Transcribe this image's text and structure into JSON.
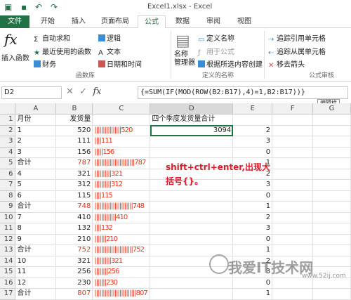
{
  "window": {
    "title": "Excel1.xlsx - Excel"
  },
  "tabs": [
    "文件",
    "开始",
    "插入",
    "页面布局",
    "公式",
    "数据",
    "审阅",
    "视图"
  ],
  "ribbon": {
    "insert_function": "插入函数",
    "autosum": "自动求和",
    "recent": "最近使用的函数",
    "financial": "财务",
    "logical": "逻辑",
    "text": "文本",
    "datetime": "日期和时间",
    "group_library": "函数库",
    "name_manager": "名称\n管理器",
    "define_name": "定义名称",
    "use_in_formula": "用于公式",
    "create_from_sel": "根据所选内容创建",
    "group_names": "定义的名称",
    "trace_prec": "追踪引用单元格",
    "trace_dep": "追踪从属单元格",
    "remove_arrows": "移去箭头",
    "group_audit": "公式审核"
  },
  "formula_bar": {
    "cell": "D2",
    "fx": "fx",
    "formula": "{=SUM(IF(MOD(ROW(B2:B17),4)=1,B2:B17))}"
  },
  "tooltip": "编辑栏",
  "columns": [
    "A",
    "B",
    "C",
    "D",
    "E",
    "F",
    "G"
  ],
  "rows": [
    {
      "n": "1",
      "a": "月份",
      "b": "发货量",
      "c": "",
      "d": "四个季度发货量合计",
      "e": "",
      "red": false
    },
    {
      "n": "2",
      "a": "1",
      "b": "520",
      "c": "||||||||||||||||520",
      "d": "3094",
      "e": "2",
      "red": false
    },
    {
      "n": "3",
      "a": "2",
      "b": "111",
      "c": "||||111",
      "d": "",
      "e": "3",
      "red": false
    },
    {
      "n": "4",
      "a": "3",
      "b": "156",
      "c": "|||||156",
      "d": "",
      "e": "0",
      "red": false
    },
    {
      "n": "5",
      "a": "合计",
      "b": "787",
      "c": "||||||||||||||||||||||||787",
      "d": "",
      "e": "1",
      "red": true
    },
    {
      "n": "6",
      "a": "4",
      "b": "321",
      "c": "||||||||||321",
      "d": "",
      "e": "2",
      "red": false
    },
    {
      "n": "7",
      "a": "5",
      "b": "312",
      "c": "||||||||||312",
      "d": "",
      "e": "3",
      "red": false
    },
    {
      "n": "8",
      "a": "6",
      "b": "115",
      "c": "||||115",
      "d": "",
      "e": "0",
      "red": false
    },
    {
      "n": "9",
      "a": "合计",
      "b": "748",
      "c": "|||||||||||||||||||||||748",
      "d": "",
      "e": "1",
      "red": true
    },
    {
      "n": "10",
      "a": "7",
      "b": "410",
      "c": "|||||||||||||410",
      "d": "",
      "e": "2",
      "red": false
    },
    {
      "n": "11",
      "a": "8",
      "b": "132",
      "c": "||||132",
      "d": "",
      "e": "3",
      "red": false
    },
    {
      "n": "12",
      "a": "9",
      "b": "210",
      "c": "|||||||210",
      "d": "",
      "e": "0",
      "red": false
    },
    {
      "n": "13",
      "a": "合计",
      "b": "752",
      "c": "|||||||||||||||||||||||752",
      "d": "",
      "e": "1",
      "red": true
    },
    {
      "n": "14",
      "a": "10",
      "b": "321",
      "c": "||||||||||321",
      "d": "",
      "e": "2",
      "red": false
    },
    {
      "n": "15",
      "a": "11",
      "b": "256",
      "c": "||||||||256",
      "d": "",
      "e": "3",
      "red": false
    },
    {
      "n": "16",
      "a": "12",
      "b": "230",
      "c": "|||||||230",
      "d": "",
      "e": "0",
      "red": false
    },
    {
      "n": "17",
      "a": "合计",
      "b": "807",
      "c": "|||||||||||||||||||||||||807",
      "d": "",
      "e": "1",
      "red": true
    }
  ],
  "annotation": "shift+ctrl+enter,出现大括号{}。",
  "watermark": {
    "text": "我爱IT技术网",
    "url": "www.52ij.com"
  }
}
